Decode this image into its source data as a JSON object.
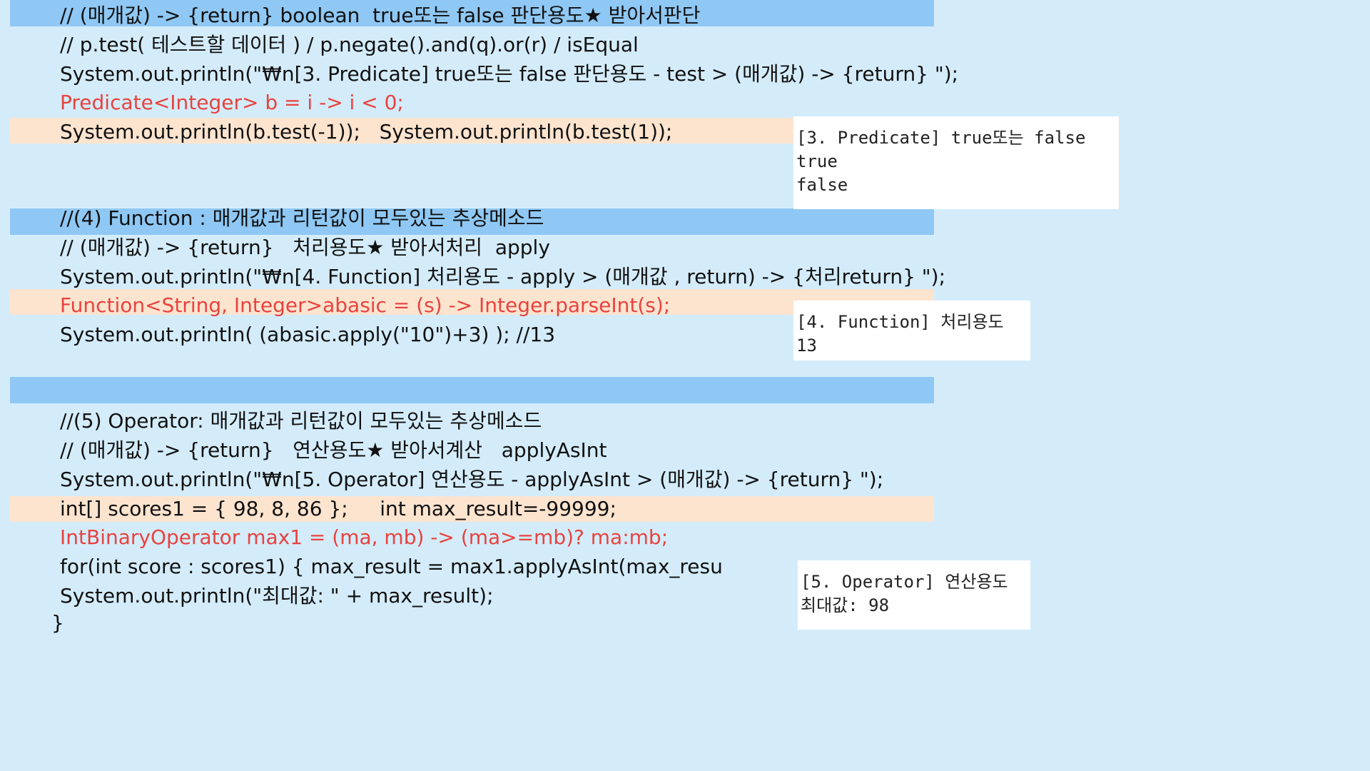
{
  "code": {
    "lines": [
      "// (매개값) -> {return} boolean  true또는 false 판단용도★ 받아서판단",
      "// p.test( 테스트할 데이터 ) / p.negate().and(q).or(r) / isEqual",
      "System.out.println(\"₩n[3. Predicate] true또는 false 판단용도 - test > (매개값) -> {return} \");",
      "Predicate<Integer> b = i -> i < 0;",
      "System.out.println(b.test(-1));   System.out.println(b.test(1));",
      "//(4) Function : 매개값과 리턴값이 모두있는 추상메소드",
      "// (매개값) -> {return}   처리용도★ 받아서처리  apply",
      "System.out.println(\"₩n[4. Function] 처리용도 - apply > (매개값 , return) -> {처리return} \");",
      "Function<String, Integer>abasic = (s) -> Integer.parseInt(s);",
      "System.out.println( (abasic.apply(\"10\")+3) ); //13",
      "//(5) Operator: 매개값과 리턴값이 모두있는 추상메소드",
      "// (매개값) -> {return}   연산용도★ 받아서계산   applyAsInt",
      "System.out.println(\"₩n[5. Operator] 연산용도 - applyAsInt > (매개값) -> {return} \");",
      "int[] scores1 = { 98, 8, 86 };     int max_result=-99999;",
      "IntBinaryOperator max1 = (ma, mb) -> (ma>=mb)? ma:mb;",
      "for(int score : scores1) { max_result = max1.applyAsInt(max_resu",
      "System.out.println(\"최대값: \" + max_result);",
      "}"
    ]
  },
  "console_outputs": [
    {
      "lines": [
        "[3. Predicate] true또는 false",
        "true",
        "false"
      ]
    },
    {
      "lines": [
        "[4. Function] 처리용도",
        "13"
      ]
    },
    {
      "lines": [
        "[5. Operator] 연산용도",
        "최대값: 98"
      ]
    }
  ],
  "colors": {
    "background": "#d4ecfa",
    "comment_band": "#8fc8f4",
    "highlight_band": "#fde4cf",
    "lambda_text": "#e8433f",
    "console_bg": "#ffffff"
  }
}
